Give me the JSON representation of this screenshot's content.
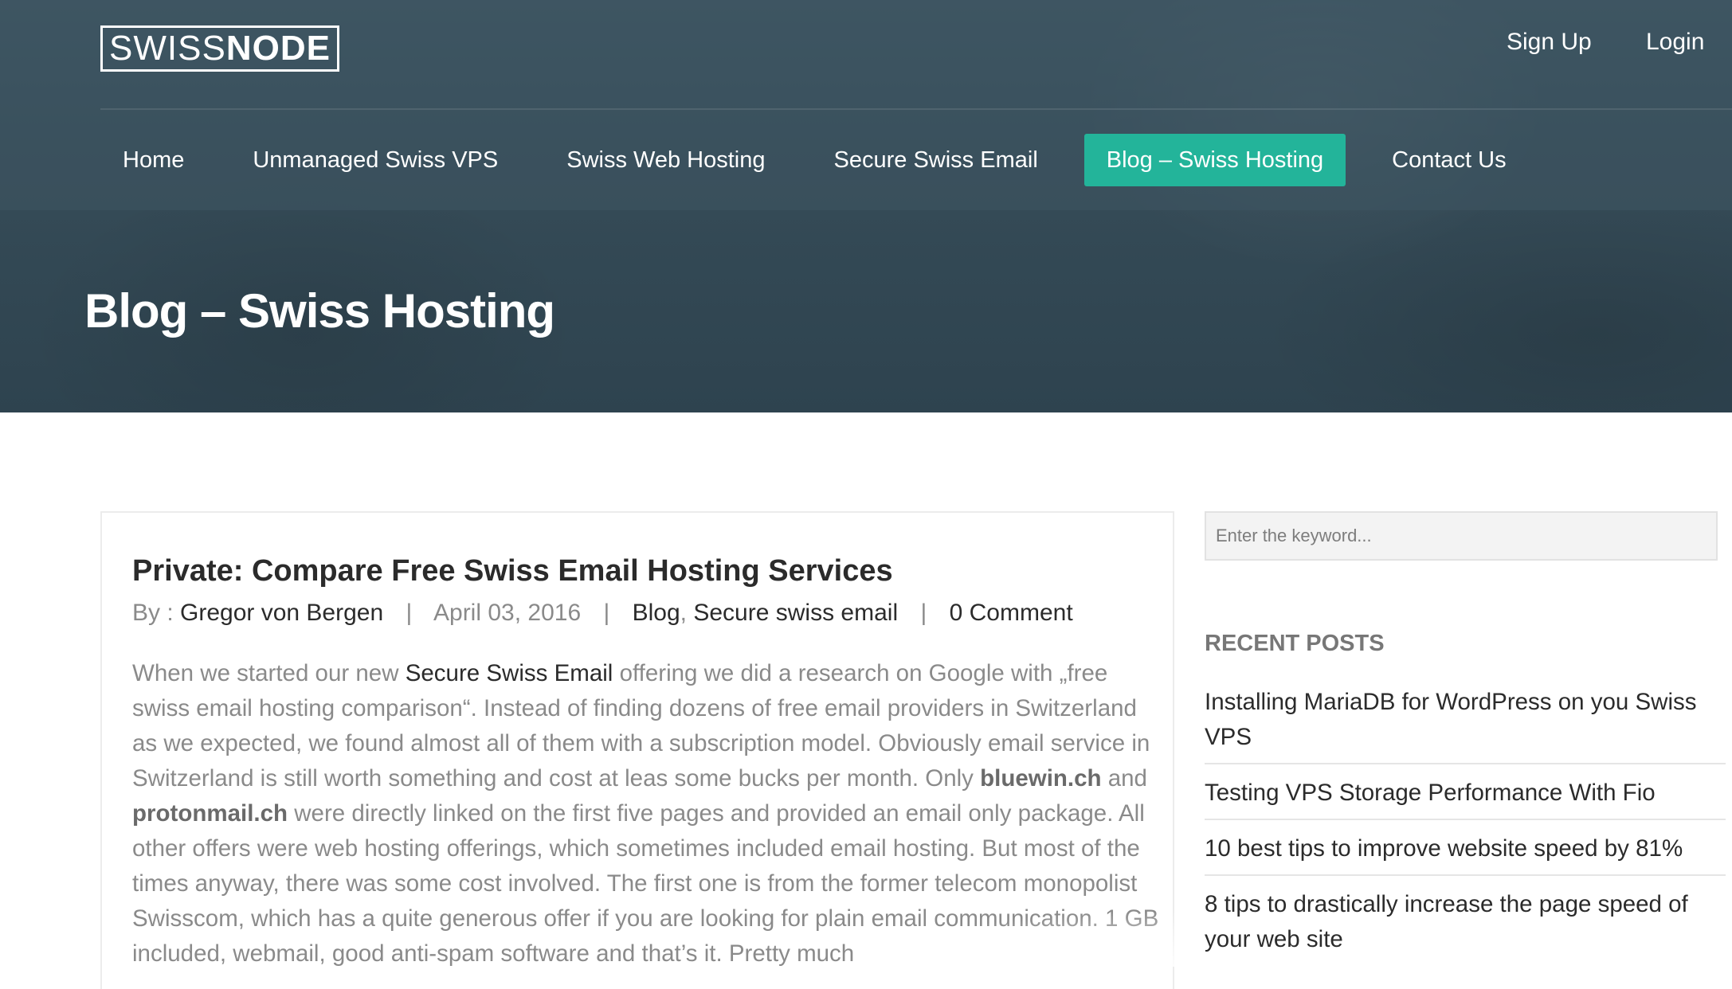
{
  "header": {
    "logo": {
      "part1": "SWISS",
      "part2": "NODE"
    },
    "top_links": {
      "signup": "Sign Up",
      "login": "Login"
    },
    "menu": [
      {
        "label": "Home",
        "active": false
      },
      {
        "label": "Unmanaged Swiss VPS",
        "active": false
      },
      {
        "label": "Swiss Web Hosting",
        "active": false
      },
      {
        "label": "Secure Swiss Email",
        "active": false
      },
      {
        "label": "Blog – Swiss Hosting",
        "active": true
      },
      {
        "label": "Contact Us",
        "active": false
      }
    ]
  },
  "page": {
    "title": "Blog – Swiss Hosting"
  },
  "post": {
    "title": "Private: Compare Free Swiss Email Hosting Services",
    "meta": {
      "by_prefix": "By : ",
      "author": "Gregor von Bergen",
      "separator": "|",
      "date": "April 03, 2016",
      "category1": "Blog",
      "category_comma": ",",
      "category2": "Secure swiss email",
      "comments": "0 Comment"
    },
    "body": {
      "p1": "When we started our new ",
      "link1": "Secure Swiss Email",
      "p2": " offering we did a research on Google with „free swiss email hosting comparison“. Instead of finding dozens of free email providers in Switzerland as we expected, we found almost all of them with a subscription model. Obviously email service in Switzerland is still worth something and cost at leas some bucks per month. Only ",
      "bold1": "bluewin.ch",
      "p3": " and ",
      "bold2": "protonmail.ch",
      "p4": " were directly linked on the first five pages and provided an email only package. All other offers were web hosting offerings, which sometimes included email hosting. But most of the times anyway, there was some cost involved. The first one is from the former telecom monopolist Swisscom, which has a quite generous offer if you are looking for plain email communication. 1 GB included, webmail, good anti-spam software and that’s it. Pretty much"
    }
  },
  "sidebar": {
    "search_placeholder": "Enter the keyword...",
    "recent_heading": "RECENT POSTS",
    "recent_posts": [
      "Installing MariaDB for WordPress on you Swiss VPS",
      "Testing VPS Storage Performance With Fio",
      "10 best tips to improve website speed by 81%",
      "8 tips to drastically increase the page speed of your web site"
    ]
  },
  "colors": {
    "accent": "#23b49a",
    "hero": "#344a56"
  }
}
